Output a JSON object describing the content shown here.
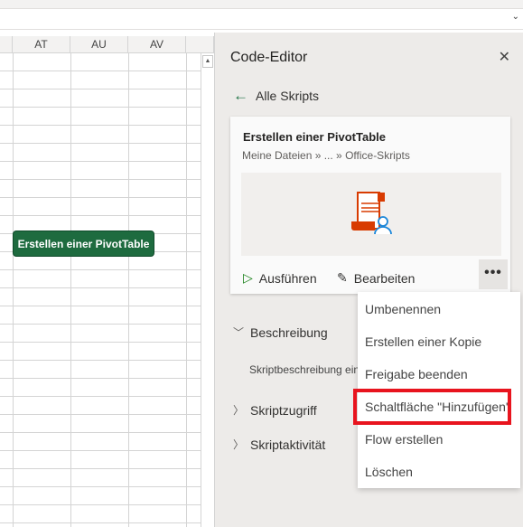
{
  "sheet": {
    "columns": [
      "AT",
      "AU",
      "AV"
    ],
    "button_label": "Erstellen einer PivotTable"
  },
  "panel": {
    "title": "Code-Editor",
    "back_label": "Alle Skripts",
    "card": {
      "title": "Erstellen einer PivotTable",
      "path": "Meine Dateien » ... » Office-Skripts",
      "run_label": "Ausführen",
      "edit_label": "Bearbeiten",
      "more_label": "•••"
    },
    "sections": {
      "description": "Beschreibung",
      "description_text": "Skriptbeschreibung eingeben",
      "access": "Skriptzugriff",
      "activity": "Skriptaktivität"
    }
  },
  "menu": {
    "items": [
      "Umbenennen",
      "Erstellen einer Kopie",
      "Freigabe beenden",
      "Schaltfläche \"Hinzufügen\"",
      "Flow erstellen",
      "Löschen"
    ],
    "highlighted_index": 3,
    "highlight_color": "#e8141e"
  },
  "colors": {
    "accent": "#217346",
    "button": "#1e6b3f"
  }
}
